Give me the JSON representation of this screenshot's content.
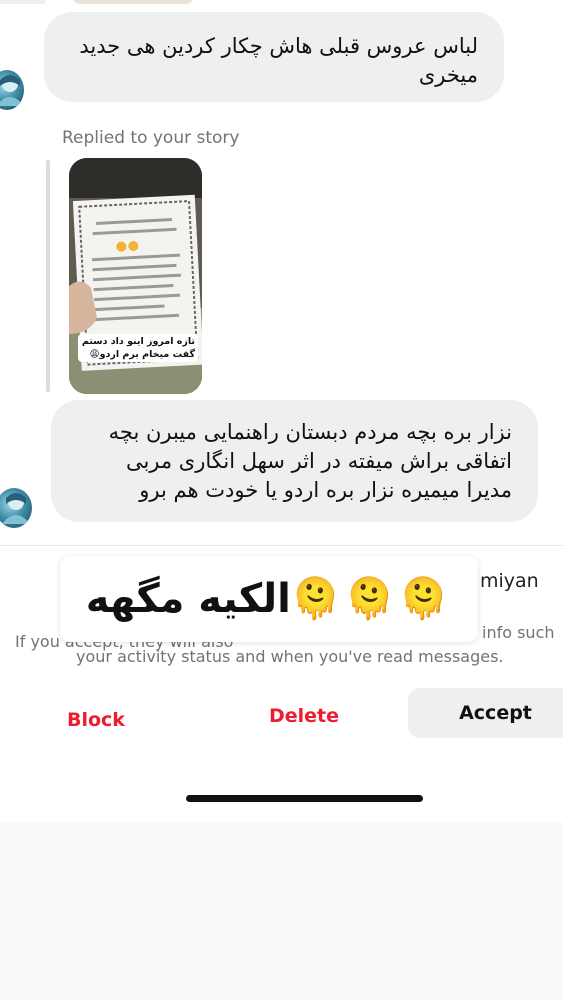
{
  "messages": [
    {
      "text": "لباس عروس قبلی هاش چکار کردین هی جدید میخری"
    },
    {
      "text": "نزار بره بچه مردم دبستان راهنمایی میبرن بچه اتفاقی براش میفته در اثر سهل انگاری مربی مدیرا میمیره نزار بره اردو یا خودت هم برو"
    }
  ],
  "story_reply": {
    "label": "Replied to your story",
    "story_caption": "تازه امروز اینو داد دستم گفت میخام برم اردو😩"
  },
  "sticker": {
    "text": "الکیه مگهه",
    "emoji": "🫠🫠🫠"
  },
  "request_notice": {
    "name_fragment": "miyan",
    "line1_left": "If you accept, they will also",
    "line1_right": "info such",
    "line2": "your activity status and when you've read messages."
  },
  "actions": {
    "block": "Block",
    "delete": "Delete",
    "accept": "Accept"
  },
  "colors": {
    "destructive": "#ed1c2e",
    "bubble": "#efefef",
    "meta_text": "#737373"
  }
}
